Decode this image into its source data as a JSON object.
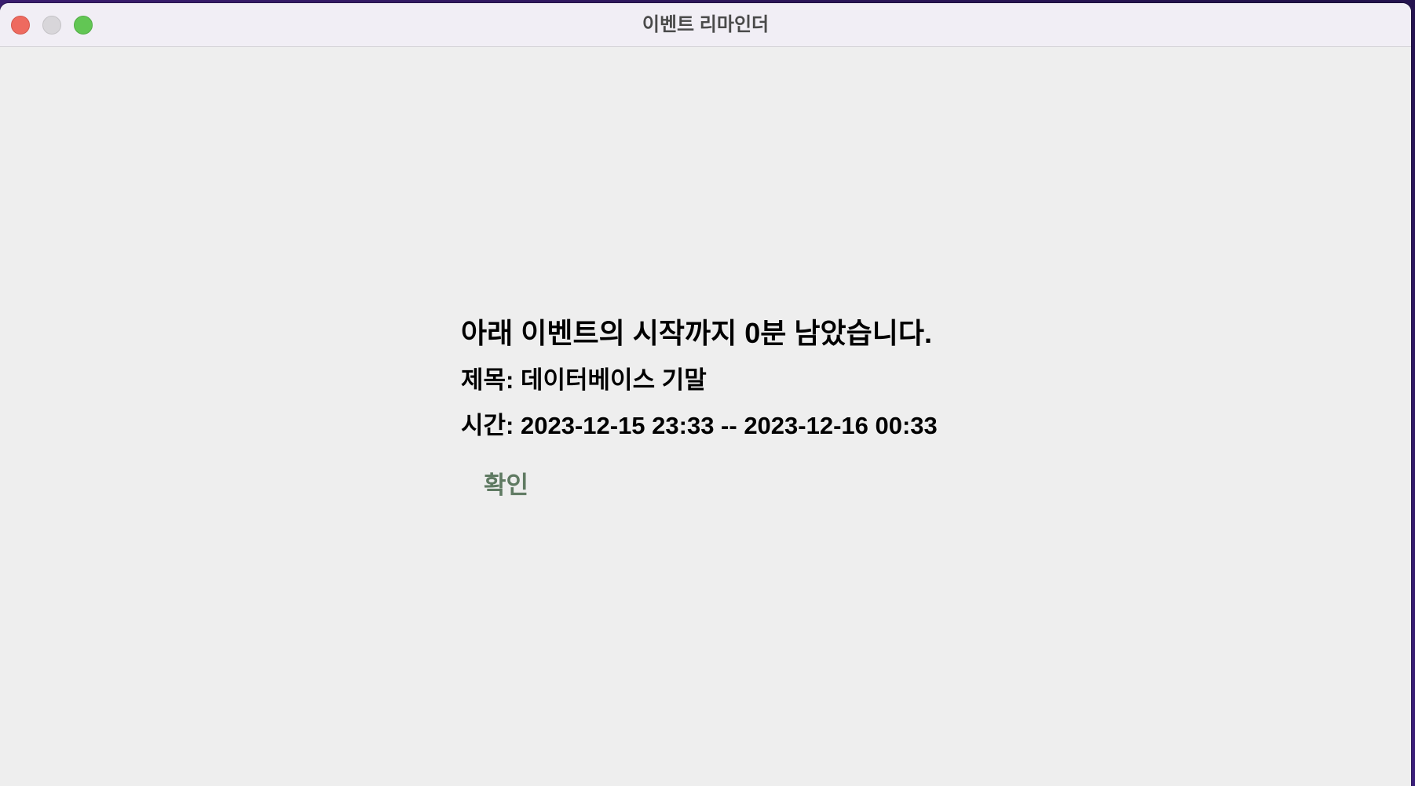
{
  "window": {
    "title": "이벤트 리마인더"
  },
  "reminder": {
    "headline": "아래 이벤트의 시작까지 0분 남았습니다.",
    "title_line": "제목: 데이터베이스 기말",
    "time_line": "시간: 2023-12-15 23:33 -- 2023-12-16 00:33",
    "confirm_label": "확인"
  },
  "colors": {
    "close": "#ee6a5f",
    "minimize": "#d8d6da",
    "zoom": "#62c654",
    "button_text": "#5f7a62",
    "window_bg": "#eeeeee"
  }
}
